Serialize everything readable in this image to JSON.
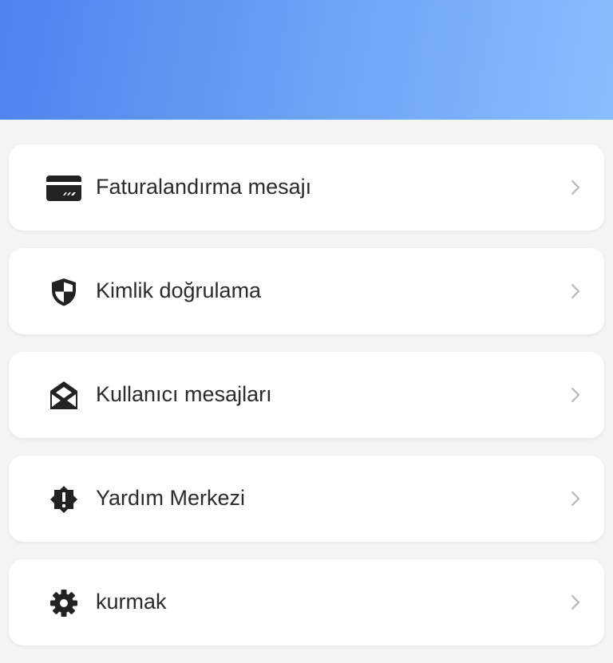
{
  "header": {
    "title": "",
    "gradient_start": "#4f82ef",
    "gradient_end": "#88bdfd"
  },
  "menu": {
    "items": [
      {
        "label": "Faturalandırma mesajı",
        "icon": "credit-card-icon"
      },
      {
        "label": "Kimlik doğrulama",
        "icon": "shield-icon"
      },
      {
        "label": "Kullanıcı mesajları",
        "icon": "open-envelope-icon"
      },
      {
        "label": "Yardım Merkezi",
        "icon": "alert-badge-icon"
      },
      {
        "label": "kurmak",
        "icon": "gear-icon"
      }
    ]
  },
  "colors": {
    "background": "#f4f4f4",
    "card": "#ffffff",
    "text": "#2b2b2b",
    "icon": "#222222",
    "chevron": "#b8b8b8"
  }
}
